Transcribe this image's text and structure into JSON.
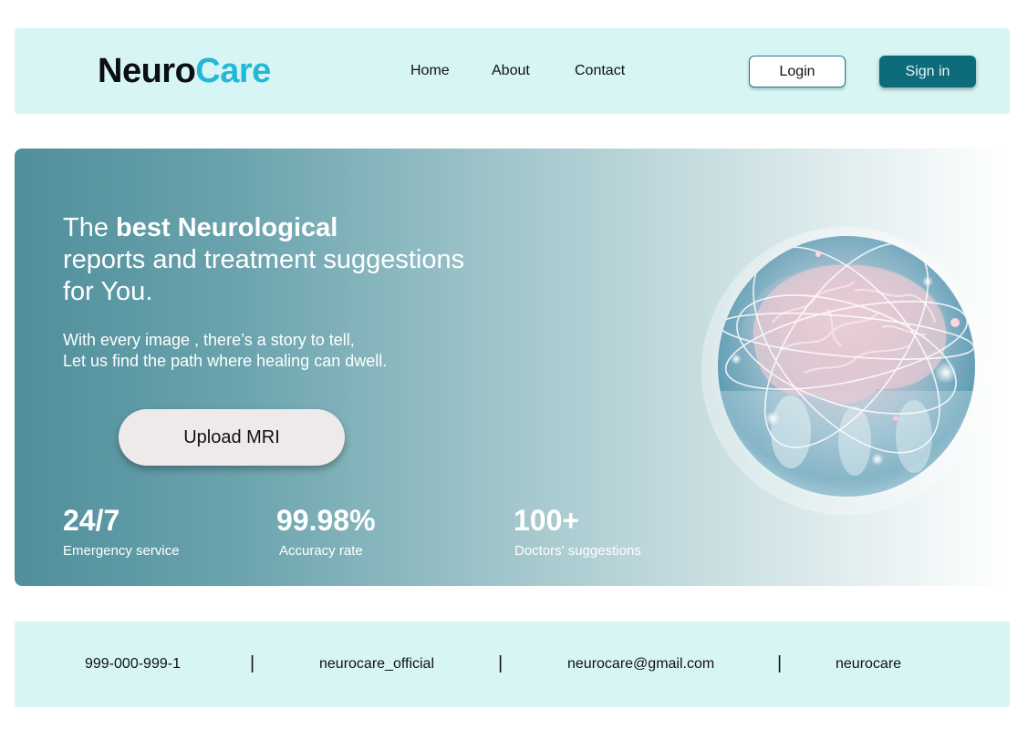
{
  "header": {
    "logo_part1": "Neuro",
    "logo_part2": "Care",
    "nav": {
      "home": "Home",
      "about": "About",
      "contact": "Contact"
    },
    "login_label": "Login",
    "signin_label": "Sign in"
  },
  "hero": {
    "headline_prefix": "The ",
    "headline_bold": "best Neurological",
    "headline_line2": "reports and treatment suggestions",
    "headline_line3": "for You.",
    "tagline_line1": "With every image , there’s a story to tell,",
    "tagline_line2": "Let us find the path where healing can dwell.",
    "upload_label": "Upload MRI",
    "image_icon": "brain-image",
    "stats": [
      {
        "value": "24/7",
        "label": "Emergency service"
      },
      {
        "value": "99.98%",
        "label": "Accuracy rate"
      },
      {
        "value": "100+",
        "label": "Doctors' suggestions"
      }
    ]
  },
  "footer": {
    "phone": "999-000-999-1",
    "separator": "|",
    "instagram": "neurocare_official",
    "email": "neurocare@gmail.com",
    "handle": "neurocare"
  },
  "colors": {
    "header_bg": "#d7f5f5",
    "logo_accent": "#22b8d6",
    "signin_bg": "#0e6b7a",
    "hero_start": "#4f8f9b",
    "upload_bg": "#eeeaeb"
  }
}
